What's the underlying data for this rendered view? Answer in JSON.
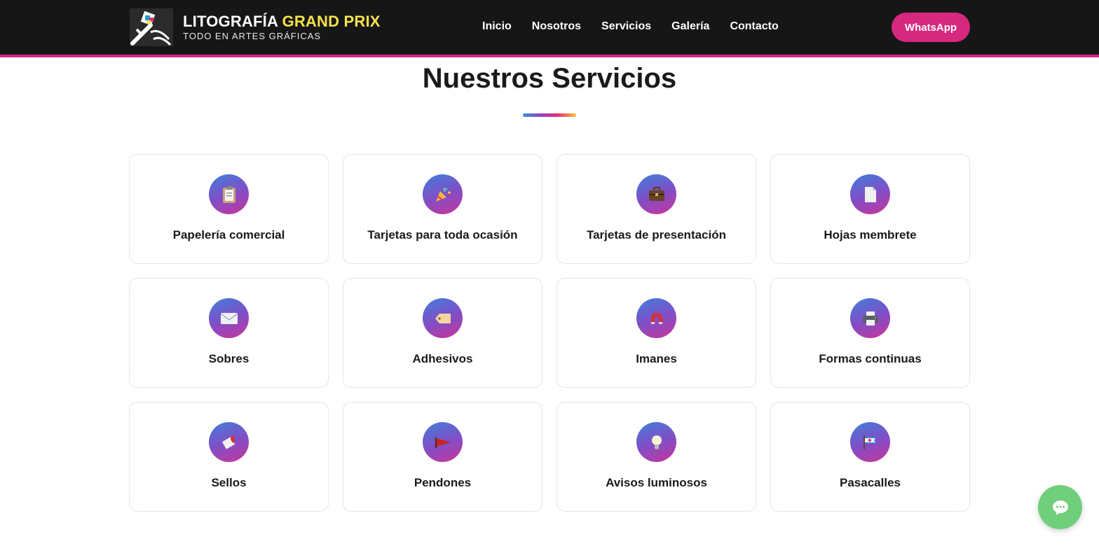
{
  "header": {
    "brand_main": "LITOGRAFÍA",
    "brand_accent": "GRAND PRIX",
    "brand_sub": "TODO EN ARTES GRÁFICAS",
    "nav": [
      {
        "label": "Inicio"
      },
      {
        "label": "Nosotros"
      },
      {
        "label": "Servicios"
      },
      {
        "label": "Galería"
      },
      {
        "label": "Contacto"
      }
    ],
    "cta_label": "WhatsApp"
  },
  "services": {
    "title": "Nuestros Servicios",
    "items": [
      {
        "label": "Papelería comercial",
        "icon": "clipboard-icon"
      },
      {
        "label": "Tarjetas para toda ocasión",
        "icon": "party-popper-icon"
      },
      {
        "label": "Tarjetas de presentación",
        "icon": "briefcase-icon"
      },
      {
        "label": "Hojas membrete",
        "icon": "document-icon"
      },
      {
        "label": "Sobres",
        "icon": "envelope-icon"
      },
      {
        "label": "Adhesivos",
        "icon": "tag-icon"
      },
      {
        "label": "Imanes",
        "icon": "magnet-icon"
      },
      {
        "label": "Formas continuas",
        "icon": "printer-icon"
      },
      {
        "label": "Sellos",
        "icon": "stamp-icon"
      },
      {
        "label": "Pendones",
        "icon": "pennant-icon"
      },
      {
        "label": "Avisos luminosos",
        "icon": "light-bulb-icon"
      },
      {
        "label": "Pasacalles",
        "icon": "banner-flags-icon"
      }
    ]
  },
  "colors": {
    "header_bg": "#161616",
    "accent_pink": "#d6287e",
    "brand_yellow": "#f6e24a",
    "chat_green": "#6fcf7b"
  },
  "chat": {
    "icon": "chat-icon"
  }
}
